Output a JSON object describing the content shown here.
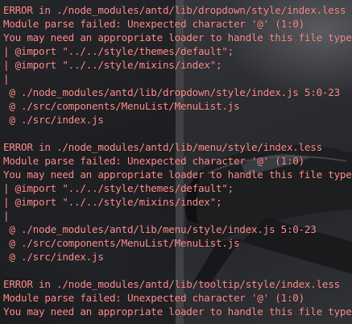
{
  "terminal": {
    "lines": [
      "ERROR in ./node_modules/antd/lib/dropdown/style/index.less",
      "Module parse failed: Unexpected character '@' (1:0)",
      "You may need an appropriate loader to handle this file type.",
      "| @import \"../../style/themes/default\";",
      "| @import \"../../style/mixins/index\";",
      "|",
      " @ ./node_modules/antd/lib/dropdown/style/index.js 5:0-23",
      " @ ./src/components/MenuList/MenuList.js",
      " @ ./src/index.js",
      "",
      "ERROR in ./node_modules/antd/lib/menu/style/index.less",
      "Module parse failed: Unexpected character '@' (1:0)",
      "You may need an appropriate loader to handle this file type.",
      "| @import \"../../style/themes/default\";",
      "| @import \"../../style/mixins/index\";",
      "|",
      " @ ./node_modules/antd/lib/menu/style/index.js 5:0-23",
      " @ ./src/components/MenuList/MenuList.js",
      " @ ./src/index.js",
      "",
      "ERROR in ./node_modules/antd/lib/tooltip/style/index.less",
      "Module parse failed: Unexpected character '@' (1:0)",
      "You may need an appropriate loader to handle this file type."
    ],
    "text_color": "#ff8f8f"
  }
}
